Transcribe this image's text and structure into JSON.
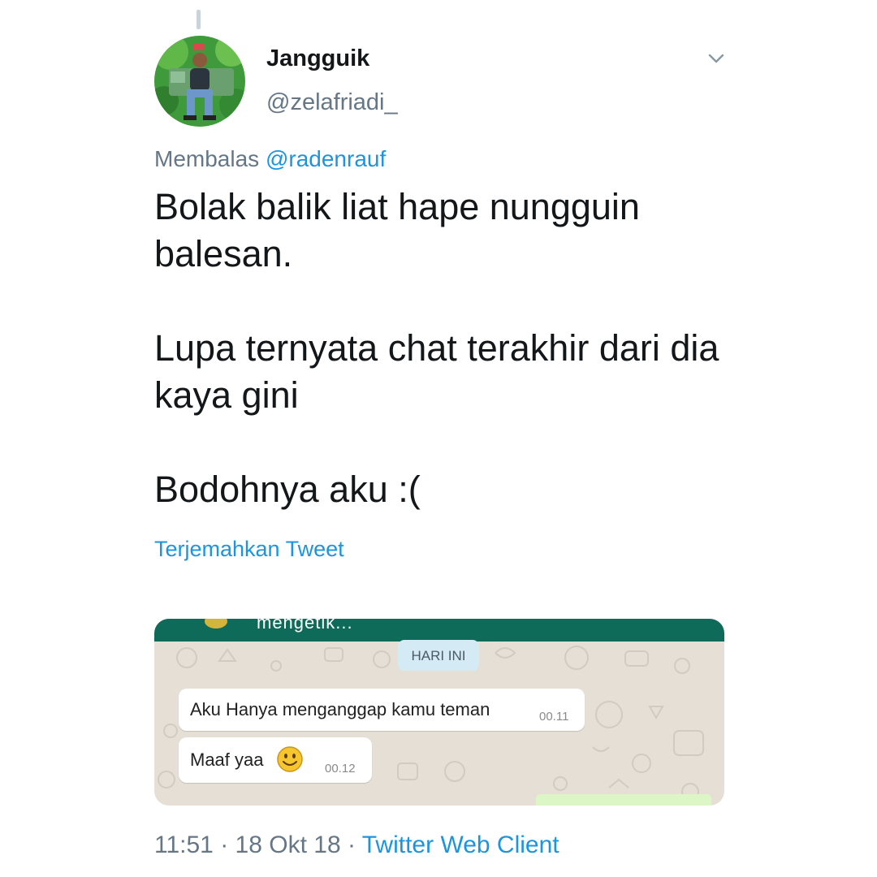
{
  "author": {
    "display_name": "Jangguik",
    "handle": "@zelafriadi_"
  },
  "reply": {
    "prefix": "Membalas",
    "mention": "@radenrauf"
  },
  "tweet": {
    "line1": "Bolak balik liat hape nungguin balesan.",
    "line2": "Lupa ternyata chat terakhir dari dia kaya gini",
    "line3": "Bodohnya aku :("
  },
  "translate_label": "Terjemahkan Tweet",
  "media": {
    "header_text": "mengetik...",
    "date_chip": "HARI INI",
    "messages": [
      {
        "text": "Aku Hanya  menganggap kamu teman",
        "time": "00.11"
      },
      {
        "text": "Maaf yaa",
        "time": "00.12",
        "emoji": "smiley-icon"
      }
    ],
    "colors": {
      "header": "#0e6b59",
      "chat_background": "#e6dfd6",
      "date_chip": "#d4eaf4",
      "outgoing_bubble": "#dcf7c5"
    }
  },
  "meta": {
    "time": "11:51",
    "separator": "·",
    "date": "18 Okt 18",
    "client": "Twitter Web Client"
  },
  "colors": {
    "link": "#1b95e0",
    "secondary_text": "#657786",
    "primary_text": "#14171a"
  },
  "icons": {
    "chevron": "chevron-down-icon",
    "avatar": "avatar"
  }
}
